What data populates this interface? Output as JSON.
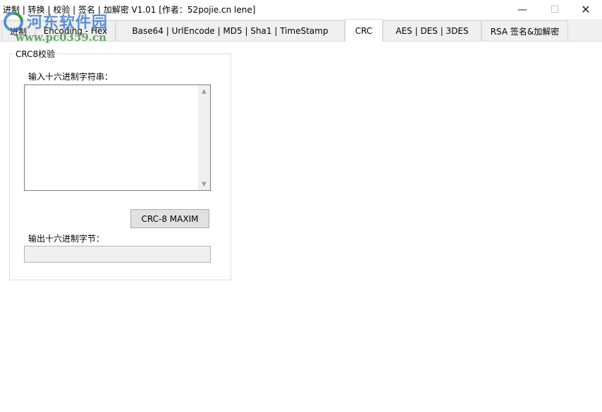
{
  "window": {
    "title": "进制 | 转换 | 校验 | 签名 | 加解密 V1.01    [作者：52pojie.cn lene]",
    "minimize_glyph": "—",
    "maximize_glyph": "☐",
    "close_glyph": "✕"
  },
  "watermark": {
    "cn_text": "河东软件园",
    "url_text": "www.pc0359.cn",
    "logo_icon": "pc0359-logo"
  },
  "tabs": [
    {
      "label": "进制",
      "active": false
    },
    {
      "label": "Encoding - Hex",
      "active": false
    },
    {
      "label": "Base64  |  UrlEncode  |  MD5  |  Sha1  |  TimeStamp",
      "active": false
    },
    {
      "label": "CRC",
      "active": true
    },
    {
      "label": "AES  |  DES  |  3DES",
      "active": false
    },
    {
      "label": "RSA 签名&加解密",
      "active": false
    }
  ],
  "crc_panel": {
    "group_title": "CRC8校验",
    "input_label": "输入十六进制字符串：",
    "input_value": "",
    "button_label": "CRC-8 MAXIM",
    "output_label": "输出十六进制字节：",
    "output_value": ""
  },
  "colors": {
    "tab_bg": "#f0f0f0",
    "active_tab_bg": "#ffffff",
    "button_bg": "#e1e1e1",
    "watermark_blue": "#286ec8",
    "watermark_green": "#3c963c"
  }
}
